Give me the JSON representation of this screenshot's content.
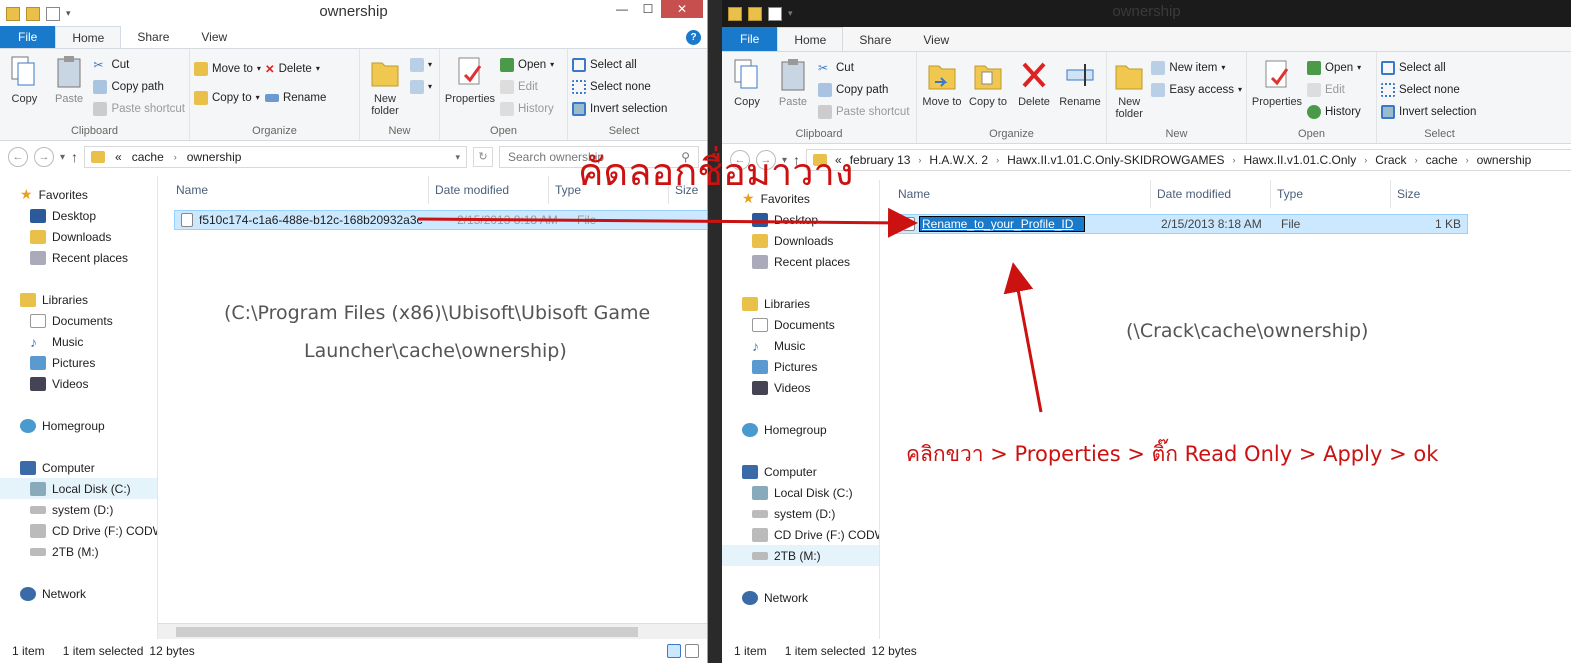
{
  "left_window": {
    "title": "ownership",
    "tabs": [
      "File",
      "Home",
      "Share",
      "View"
    ],
    "ribbon": {
      "clipboard": {
        "copy": "Copy",
        "paste": "Paste",
        "cut": "Cut",
        "copy_path": "Copy path",
        "paste_shortcut": "Paste shortcut",
        "label": "Clipboard"
      },
      "organize": {
        "move_to": "Move to",
        "copy_to": "Copy to",
        "delete": "Delete",
        "rename": "Rename",
        "label": "Organize"
      },
      "new": {
        "new_folder": "New folder",
        "label": "New"
      },
      "open": {
        "properties": "Properties",
        "open": "Open",
        "edit": "Edit",
        "history": "History",
        "label": "Open"
      },
      "select": {
        "select_all": "Select all",
        "select_none": "Select none",
        "invert": "Invert selection",
        "label": "Select"
      }
    },
    "breadcrumb": [
      "«",
      "cache",
      "ownership"
    ],
    "search_placeholder": "Search ownership",
    "columns": [
      "Name",
      "Date modified",
      "Type",
      "Size"
    ],
    "file": {
      "name": "f510c174-c1a6-488e-b12c-168b20932a3c",
      "date": "2/15/2013 8:18 AM",
      "type": "File"
    },
    "nav": {
      "favorites": "Favorites",
      "desktop": "Desktop",
      "downloads": "Downloads",
      "recent": "Recent places",
      "libraries": "Libraries",
      "documents": "Documents",
      "music": "Music",
      "pictures": "Pictures",
      "videos": "Videos",
      "homegroup": "Homegroup",
      "computer": "Computer",
      "local_disk": "Local Disk (C:)",
      "system": "system (D:)",
      "cd": "CD Drive (F:) CODW.",
      "tb": "2TB (M:)",
      "network": "Network"
    },
    "status": {
      "count": "1 item",
      "selected": "1 item selected",
      "size": "12 bytes"
    },
    "annotation_path_1": "(C:\\Program Files (x86)\\Ubisoft\\Ubisoft Game",
    "annotation_path_2": "Launcher\\cache\\ownership)"
  },
  "right_window": {
    "title": "ownership",
    "tabs": [
      "File",
      "Home",
      "Share",
      "View"
    ],
    "ribbon": {
      "clipboard": {
        "copy": "Copy",
        "paste": "Paste",
        "cut": "Cut",
        "copy_path": "Copy path",
        "paste_shortcut": "Paste shortcut",
        "label": "Clipboard"
      },
      "organize": {
        "move": "Move to",
        "copy": "Copy to",
        "delete": "Delete",
        "rename": "Rename",
        "label": "Organize"
      },
      "new": {
        "new_folder": "New folder",
        "new_item": "New item",
        "easy_access": "Easy access",
        "label": "New"
      },
      "open": {
        "properties": "Properties",
        "open": "Open",
        "edit": "Edit",
        "history": "History",
        "label": "Open"
      },
      "select": {
        "select_all": "Select all",
        "select_none": "Select none",
        "invert": "Invert selection",
        "label": "Select"
      }
    },
    "breadcrumb": [
      "«",
      "february 13",
      "H.A.W.X. 2",
      "Hawx.II.v1.01.C.Only-SKIDROWGAMES",
      "Hawx.II.v1.01.C.Only",
      "Crack",
      "cache",
      "ownership"
    ],
    "columns": [
      "Name",
      "Date modified",
      "Type",
      "Size"
    ],
    "file": {
      "name": "Rename_to_your_Profile_ID",
      "date": "2/15/2013 8:18 AM",
      "type": "File",
      "size": "1 KB"
    },
    "nav": {
      "favorites": "Favorites",
      "desktop": "Desktop",
      "downloads": "Downloads",
      "recent": "Recent places",
      "libraries": "Libraries",
      "documents": "Documents",
      "music": "Music",
      "pictures": "Pictures",
      "videos": "Videos",
      "homegroup": "Homegroup",
      "computer": "Computer",
      "local_disk": "Local Disk (C:)",
      "system": "system (D:)",
      "cd": "CD Drive (F:) CODW.",
      "tb": "2TB (M:)",
      "network": "Network"
    },
    "status": {
      "count": "1 item",
      "selected": "1 item selected",
      "size": "12 bytes"
    },
    "annotation_path": "(\\Crack\\cache\\ownership)",
    "annotation_steps": "คลิกขวา > Properties > ติ๊ก Read Only > Apply > ok"
  },
  "annotation_copy": "คัดลอกชื่อมาวาง",
  "colors": {
    "accent": "#1979ca",
    "annotation_red": "#c11111",
    "selection": "#cce8ff"
  }
}
